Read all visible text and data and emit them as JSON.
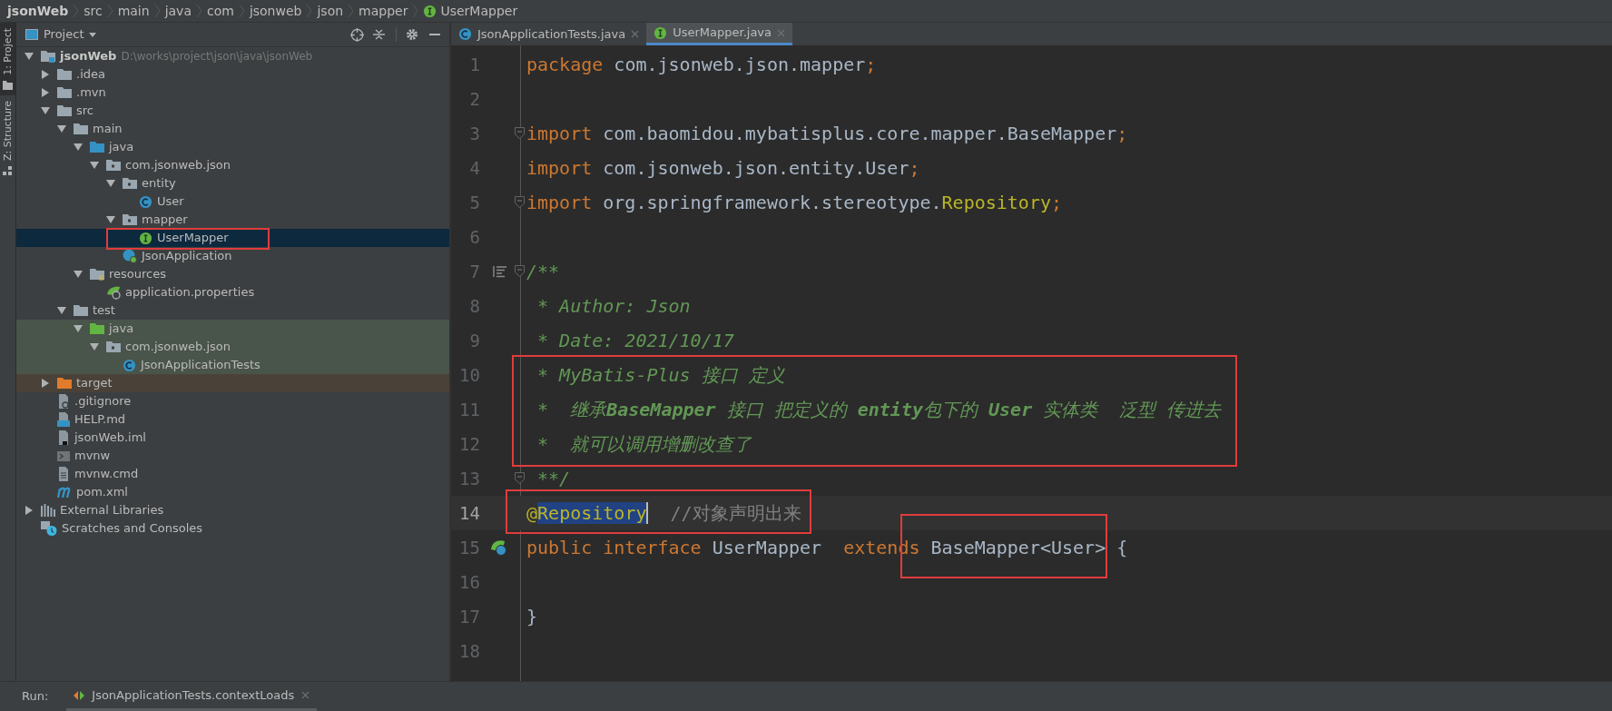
{
  "breadcrumb": [
    {
      "label": "jsonWeb",
      "kind": "project"
    },
    {
      "label": "src",
      "kind": "folder"
    },
    {
      "label": "main",
      "kind": "folder"
    },
    {
      "label": "java",
      "kind": "folder"
    },
    {
      "label": "com",
      "kind": "folder"
    },
    {
      "label": "jsonweb",
      "kind": "folder"
    },
    {
      "label": "json",
      "kind": "folder"
    },
    {
      "label": "mapper",
      "kind": "folder"
    },
    {
      "label": "UserMapper",
      "kind": "interface"
    }
  ],
  "side_tabs": [
    {
      "label": "1: Project",
      "selected": true
    },
    {
      "label": "Z: Structure",
      "selected": false
    }
  ],
  "project": {
    "title": "Project",
    "tree": [
      {
        "label": "jsonWeb",
        "path": "D:\\works\\project\\json\\java\\jsonWeb",
        "kind": "module",
        "expanded": true,
        "selected": false,
        "children": [
          {
            "label": ".idea",
            "kind": "folder",
            "expanded": false,
            "selected": false
          },
          {
            "label": ".mvn",
            "kind": "folder",
            "expanded": false,
            "selected": false
          },
          {
            "label": "src",
            "kind": "folder",
            "expanded": true,
            "selected": false,
            "children": [
              {
                "label": "main",
                "kind": "folder",
                "expanded": true,
                "selected": false,
                "children": [
                  {
                    "label": "java",
                    "kind": "source-folder",
                    "expanded": true,
                    "selected": false,
                    "children": [
                      {
                        "label": "com.jsonweb.json",
                        "kind": "package",
                        "expanded": true,
                        "selected": false,
                        "children": [
                          {
                            "label": "entity",
                            "kind": "package",
                            "expanded": true,
                            "selected": false,
                            "children": [
                              {
                                "label": "User",
                                "kind": "class",
                                "selected": false
                              }
                            ]
                          },
                          {
                            "label": "mapper",
                            "kind": "package",
                            "expanded": true,
                            "selected": false,
                            "children": [
                              {
                                "label": "UserMapper",
                                "kind": "interface",
                                "selected": true
                              }
                            ]
                          },
                          {
                            "label": "JsonApplication",
                            "kind": "spring-class",
                            "selected": false
                          }
                        ]
                      }
                    ]
                  },
                  {
                    "label": "resources",
                    "kind": "resources",
                    "expanded": true,
                    "selected": false,
                    "children": [
                      {
                        "label": "application.properties",
                        "kind": "properties",
                        "selected": false
                      }
                    ]
                  }
                ]
              },
              {
                "label": "test",
                "kind": "folder",
                "expanded": true,
                "selected": false,
                "children": [
                  {
                    "label": "java",
                    "kind": "test-folder",
                    "expanded": true,
                    "selected": false,
                    "children": [
                      {
                        "label": "com.jsonweb.json",
                        "kind": "test-package",
                        "expanded": true,
                        "selected": false,
                        "children": [
                          {
                            "label": "JsonApplicationTests",
                            "kind": "test-class",
                            "selected": false
                          }
                        ]
                      }
                    ]
                  }
                ]
              }
            ]
          },
          {
            "label": "target",
            "kind": "excluded-folder",
            "expanded": false,
            "selected": false
          },
          {
            "label": ".gitignore",
            "kind": "gitignore",
            "selected": false
          },
          {
            "label": "HELP.md",
            "kind": "markdown",
            "selected": false
          },
          {
            "label": "jsonWeb.iml",
            "kind": "iml",
            "selected": false
          },
          {
            "label": "mvnw",
            "kind": "script",
            "selected": false
          },
          {
            "label": "mvnw.cmd",
            "kind": "text-file",
            "selected": false
          },
          {
            "label": "pom.xml",
            "kind": "maven",
            "selected": false
          }
        ]
      },
      {
        "label": "External Libraries",
        "kind": "libraries",
        "expanded": false,
        "selected": false
      },
      {
        "label": "Scratches and Consoles",
        "kind": "scratches",
        "selected": false
      }
    ]
  },
  "editor": {
    "tabs": [
      {
        "label": "JsonApplicationTests.java",
        "kind": "class",
        "selected": false
      },
      {
        "label": "UserMapper.java",
        "kind": "interface",
        "selected": true
      }
    ],
    "lines": [
      {
        "number": "1",
        "current": false,
        "tokens": [
          {
            "text": "package",
            "kind": "keyword"
          },
          {
            "text": " com.jsonweb.json.mapper",
            "kind": "plain"
          },
          {
            "text": ";",
            "kind": "punct"
          }
        ]
      },
      {
        "number": "2",
        "current": false
      },
      {
        "number": "3",
        "current": false,
        "kind": "fold",
        "tokens": [
          {
            "text": "import",
            "kind": "keyword"
          },
          {
            "text": " com.baomidou.mybatisplus.core.mapper.BaseMapper",
            "kind": "plain"
          },
          {
            "text": ";",
            "kind": "punct"
          }
        ]
      },
      {
        "number": "4",
        "current": false,
        "tokens": [
          {
            "text": "import",
            "kind": "keyword"
          },
          {
            "text": " com.jsonweb.json.entity.User",
            "kind": "plain"
          },
          {
            "text": ";",
            "kind": "punct"
          }
        ]
      },
      {
        "number": "5",
        "current": false,
        "kind": "fold",
        "tokens": [
          {
            "text": "import",
            "kind": "keyword"
          },
          {
            "text": " org.springframework.stereotype.",
            "kind": "plain"
          },
          {
            "text": "Repository",
            "kind": "annotation"
          },
          {
            "text": ";",
            "kind": "punct"
          }
        ]
      },
      {
        "number": "6",
        "current": false
      },
      {
        "number": "7",
        "current": false,
        "kind": "doc-fold",
        "tokens": [
          {
            "text": "/**",
            "kind": "doc"
          }
        ]
      },
      {
        "number": "8",
        "current": false,
        "tokens": [
          {
            "text": " * Author: Json",
            "kind": "doc"
          }
        ]
      },
      {
        "number": "9",
        "current": false,
        "tokens": [
          {
            "text": " * Date: 2021/10/17",
            "kind": "doc"
          }
        ]
      },
      {
        "number": "10",
        "current": false,
        "tokens": [
          {
            "text": " * MyBatis-Plus 接口 定义",
            "kind": "doc"
          }
        ]
      },
      {
        "number": "11",
        "current": false,
        "tokens": [
          {
            "text": " *  继承",
            "kind": "doc"
          },
          {
            "text": "BaseMapper",
            "kind": "doc-bold"
          },
          {
            "text": " 接口 把定义的 ",
            "kind": "doc"
          },
          {
            "text": "entity",
            "kind": "doc-bold"
          },
          {
            "text": "包下的 ",
            "kind": "doc"
          },
          {
            "text": "User",
            "kind": "doc-bold"
          },
          {
            "text": " 实体类  泛型 传进去",
            "kind": "doc"
          }
        ]
      },
      {
        "number": "12",
        "current": false,
        "tokens": [
          {
            "text": " *  就可以调用增删改查了",
            "kind": "doc"
          }
        ]
      },
      {
        "number": "13",
        "current": false,
        "kind": "fold",
        "tokens": [
          {
            "text": " **/",
            "kind": "doc"
          }
        ]
      },
      {
        "number": "14",
        "current": true,
        "tokens": [
          {
            "text": "@",
            "kind": "annotation"
          },
          {
            "text": "Repository",
            "kind": "selection"
          },
          {
            "text": "  //对象声明出来",
            "kind": "comment"
          }
        ]
      },
      {
        "number": "15",
        "current": false,
        "kind": "impl",
        "tokens": [
          {
            "text": "public interface",
            "kind": "keyword"
          },
          {
            "text": " UserMapper  ",
            "kind": "plain"
          },
          {
            "text": "extends",
            "kind": "keyword"
          },
          {
            "text": " BaseMapper<User> {",
            "kind": "plain"
          }
        ]
      },
      {
        "number": "16",
        "current": false
      },
      {
        "number": "17",
        "current": false,
        "tokens": [
          {
            "text": "}",
            "kind": "plain"
          }
        ]
      },
      {
        "number": "18",
        "current": false
      }
    ]
  },
  "run_bar": {
    "label": "Run:",
    "tab": "JsonApplicationTests.contextLoads"
  }
}
